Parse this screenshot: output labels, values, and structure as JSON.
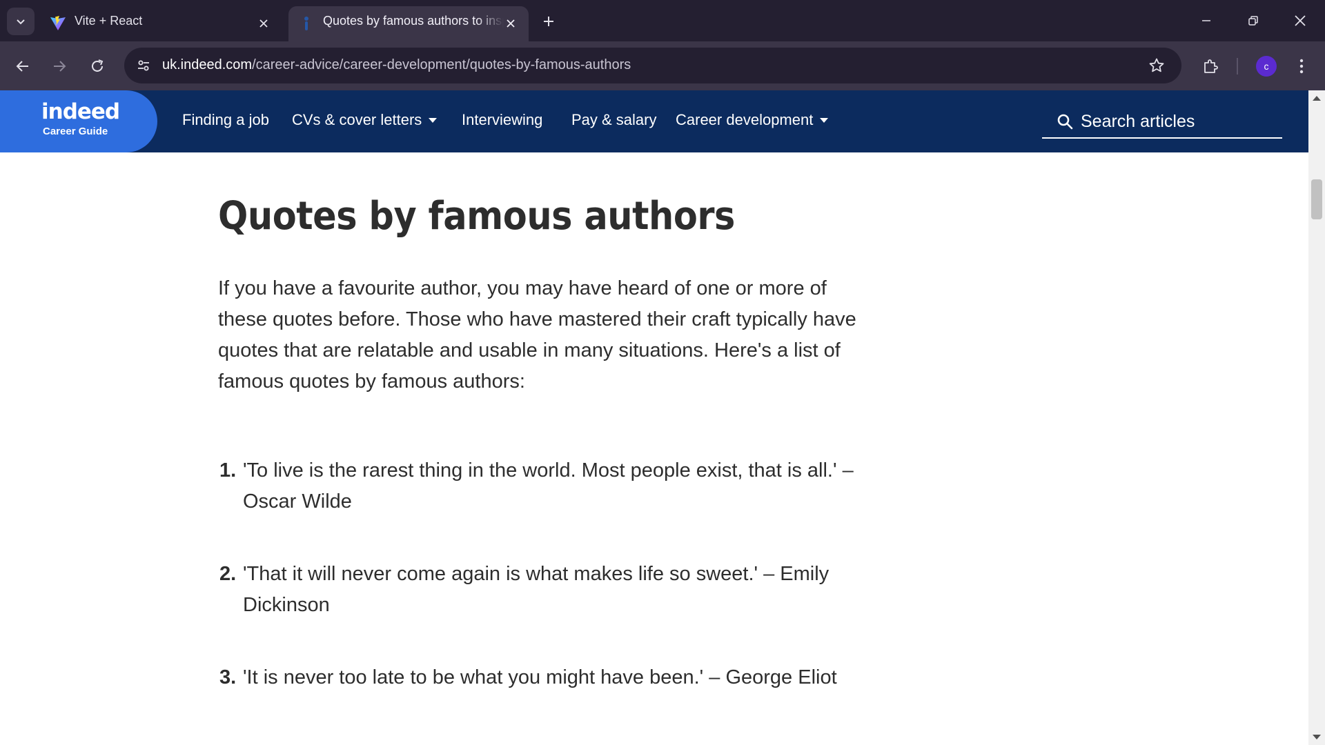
{
  "browser": {
    "tabs": [
      {
        "title": "Vite + React",
        "icon": "vite-favicon",
        "active": false
      },
      {
        "title": "Quotes by famous authors to inspire you",
        "icon": "indeed-favicon",
        "active": true
      }
    ],
    "url_host": "uk.indeed.com",
    "url_path": "/career-advice/career-development/quotes-by-famous-authors",
    "profile_initial": "c",
    "colors": {
      "tabstrip": "#241f31",
      "toolbar": "#3b3548",
      "profile": "#5b2bd0"
    }
  },
  "site": {
    "logo": "indeed",
    "logo_sub": "Career Guide",
    "nav": [
      {
        "label": "Finding a job",
        "dropdown": false
      },
      {
        "label": "CVs & cover letters",
        "dropdown": true
      },
      {
        "label": "Interviewing",
        "dropdown": false
      },
      {
        "label": "Pay & salary",
        "dropdown": false
      },
      {
        "label": "Career development",
        "dropdown": true
      }
    ],
    "search_label": "Search articles",
    "colors": {
      "header": "#0c2b5e",
      "brand": "#2e6dde"
    }
  },
  "article": {
    "title": "Quotes by famous authors",
    "intro": "If you have a favourite author, you may have heard of one or more of these quotes before. Those who have mastered their craft typically have quotes that are relatable and usable in many situations. Here's a list of famous quotes by famous authors:",
    "quotes": [
      {
        "num": "1.",
        "text": "'To live is the rarest thing in the world. Most people exist, that is all.' – Oscar Wilde"
      },
      {
        "num": "2.",
        "text": "'That it will never come again is what makes life so sweet.' – Emily Dickinson"
      },
      {
        "num": "3.",
        "text": "'It is never too late to be what you might have been.' – George Eliot"
      }
    ]
  }
}
